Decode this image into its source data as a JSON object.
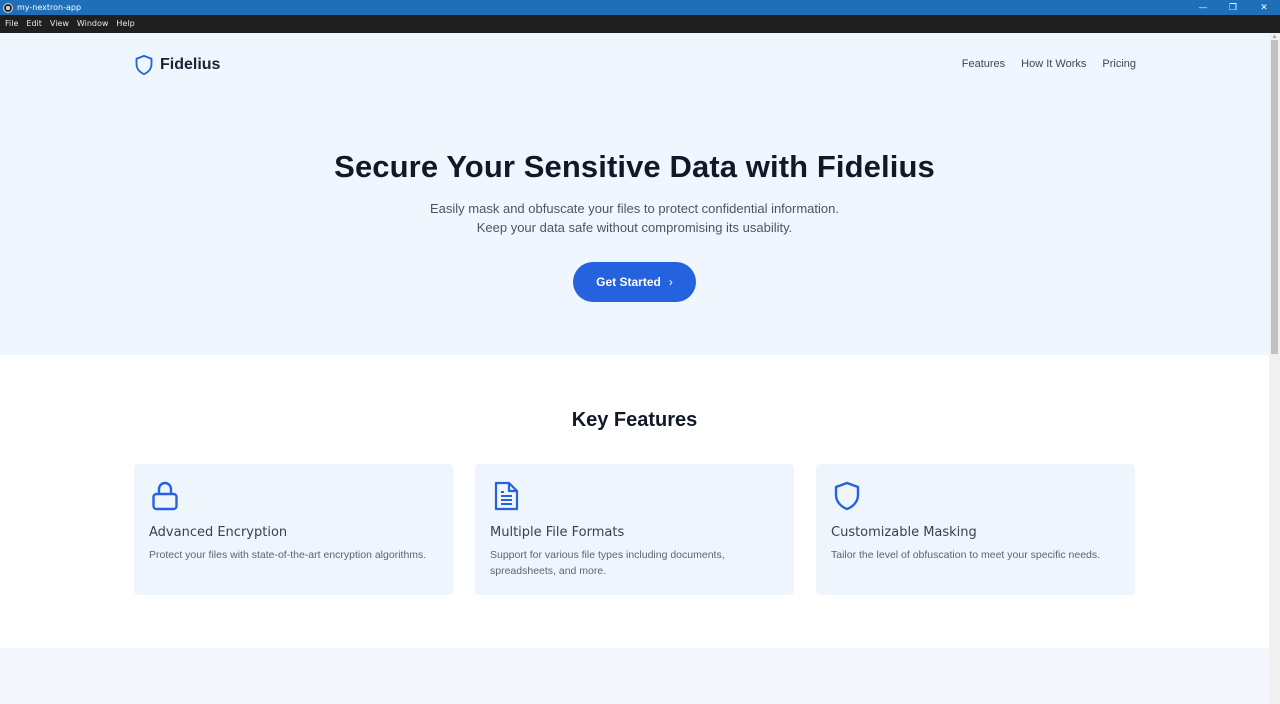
{
  "window": {
    "title": "my-nextron-app",
    "controls": {
      "minimize": "—",
      "restore": "❐",
      "close": "✕"
    }
  },
  "menubar": {
    "items": [
      "File",
      "Edit",
      "View",
      "Window",
      "Help"
    ]
  },
  "nav": {
    "brand": "Fidelius",
    "logo_icon": "shield-icon",
    "links": [
      "Features",
      "How It Works",
      "Pricing"
    ]
  },
  "hero": {
    "title": "Secure Your Sensitive Data with Fidelius",
    "subtitle_line1": "Easily mask and obfuscate your files to protect confidential information.",
    "subtitle_line2": "Keep your data safe without compromising its usability.",
    "cta_label": "Get Started",
    "cta_chevron": "›"
  },
  "features": {
    "title": "Key Features",
    "cards": [
      {
        "icon": "lock-icon",
        "title": "Advanced Encryption",
        "description": "Protect your files with state-of-the-art encryption algorithms."
      },
      {
        "icon": "document-icon",
        "title": "Multiple File Formats",
        "description": "Support for various file types including documents, spreadsheets, and more."
      },
      {
        "icon": "shield-icon",
        "title": "Customizable Masking",
        "description": "Tailor the level of obfuscation to meet your specific needs."
      }
    ]
  },
  "colors": {
    "accent": "#2462de",
    "hero_bg": "#f0f6fd",
    "card_bg": "#eff5fd",
    "titlebar": "#1e6fb8",
    "menubar": "#1f1f1f"
  }
}
